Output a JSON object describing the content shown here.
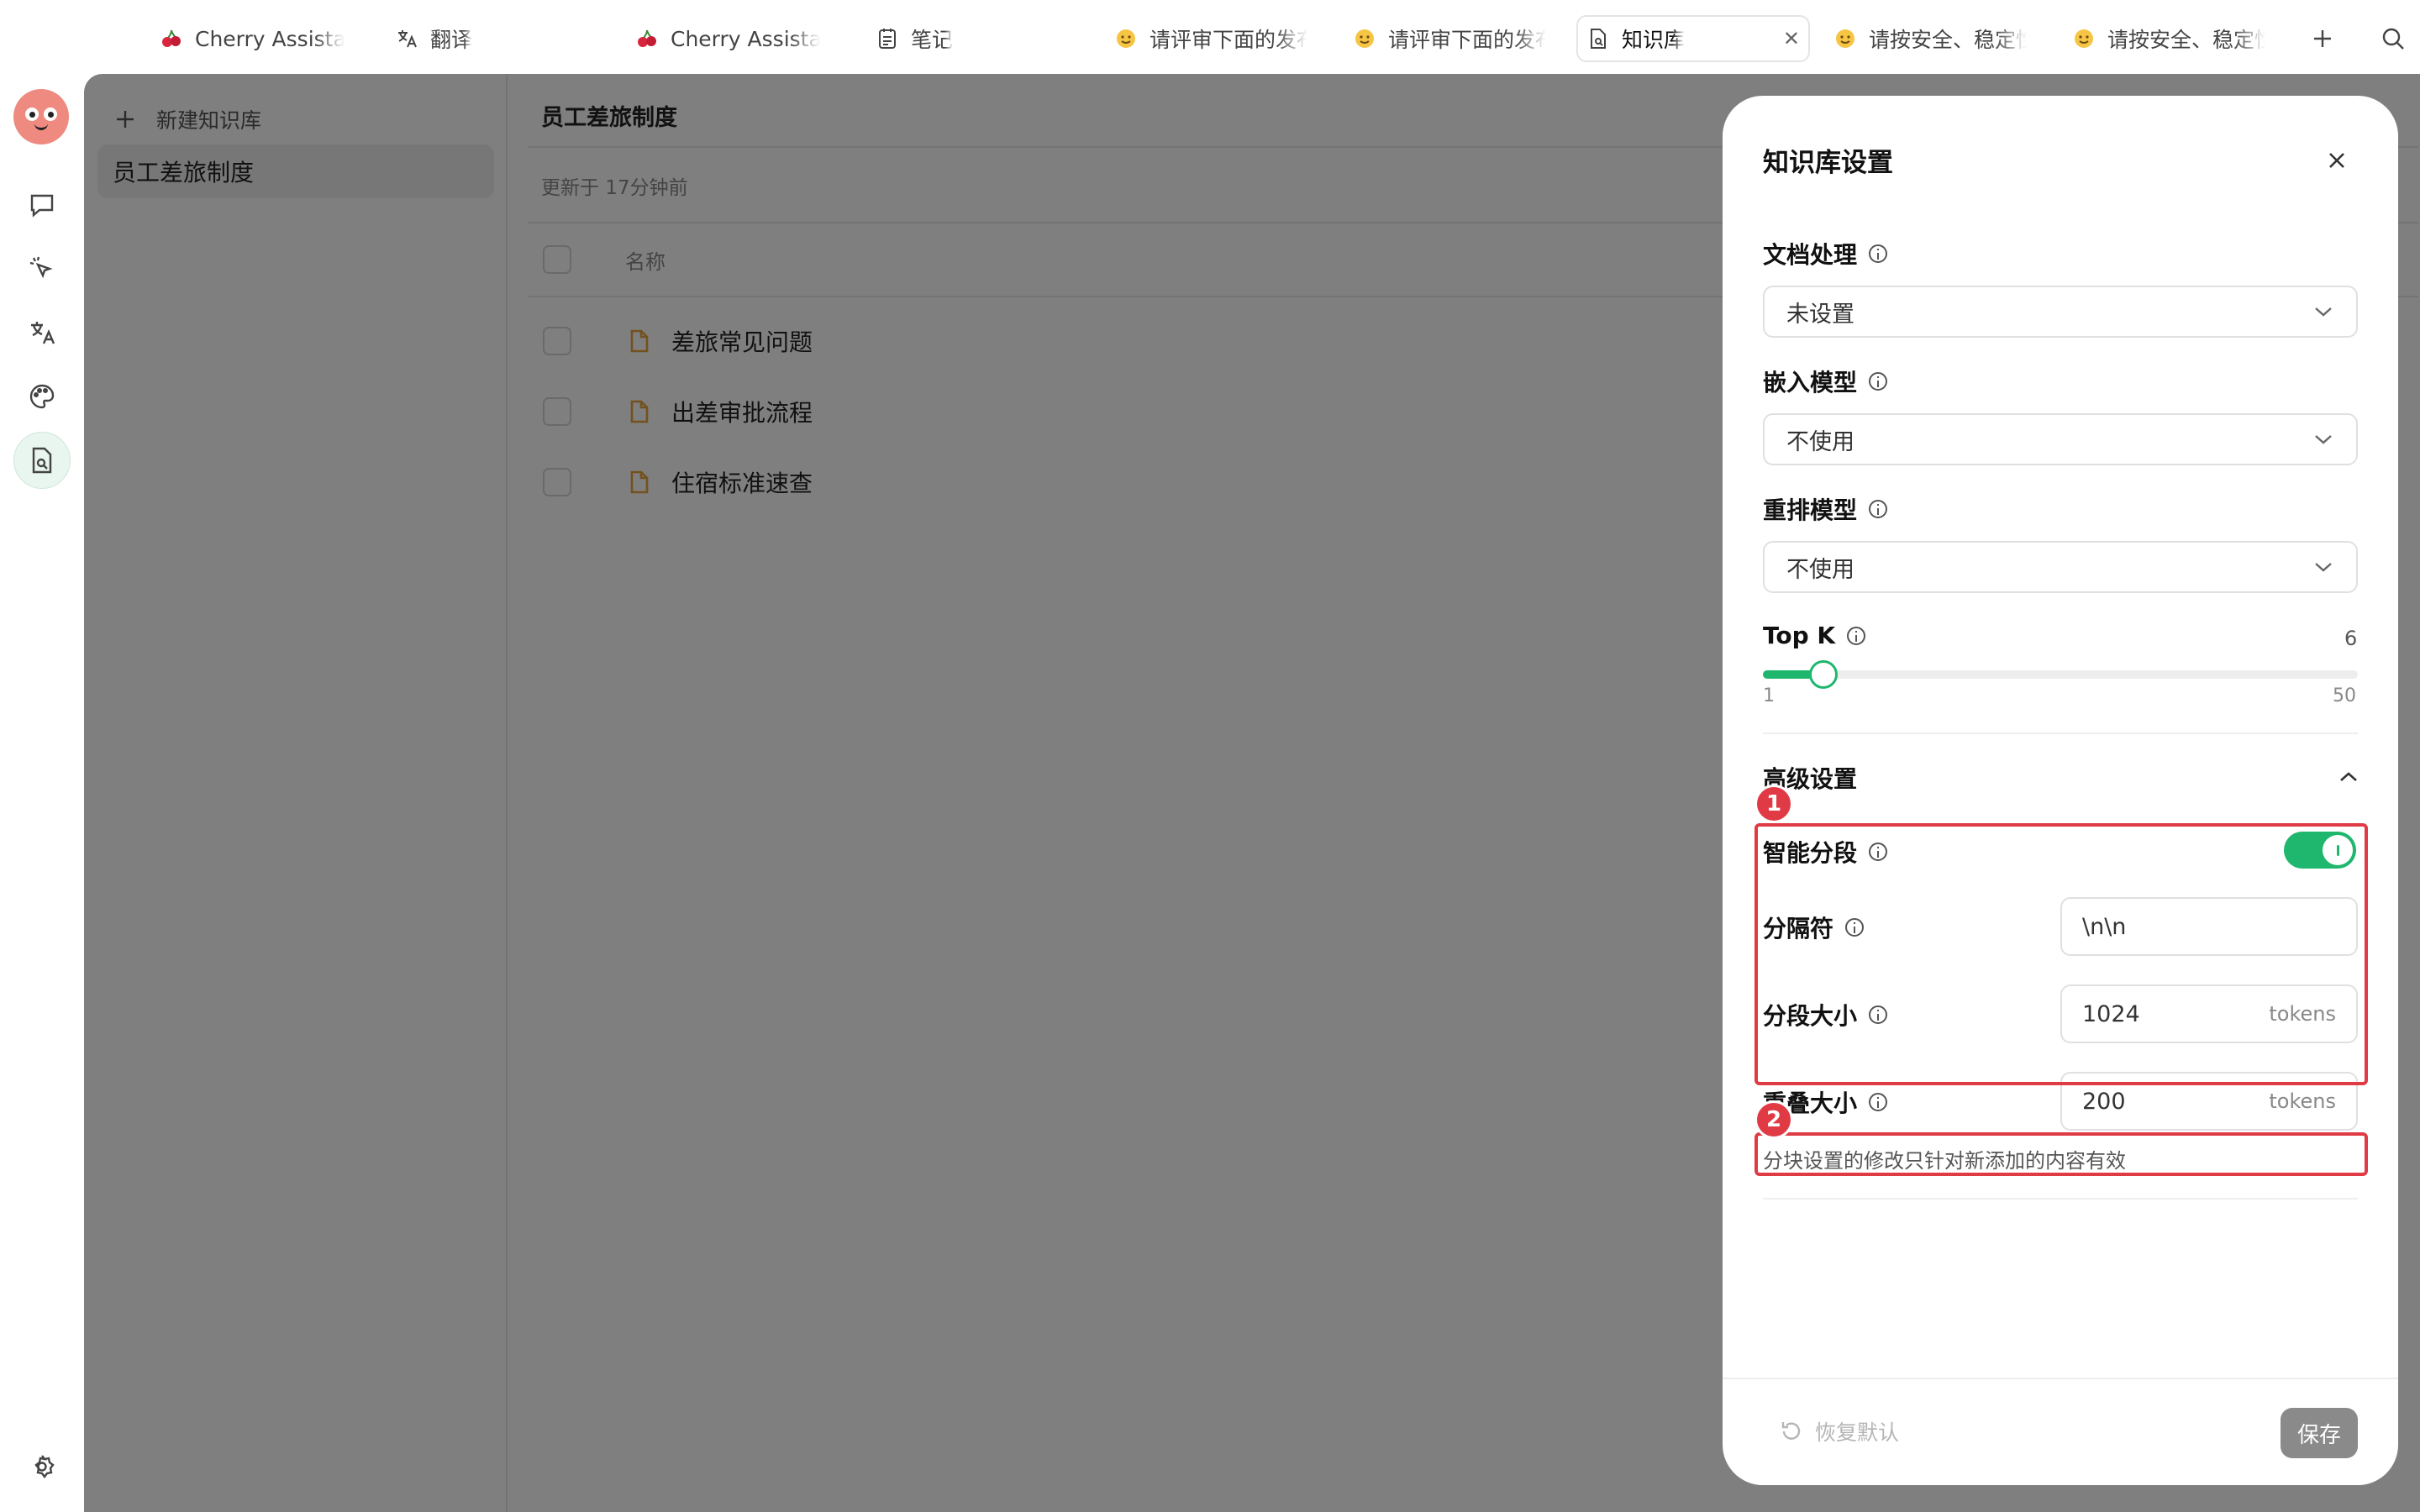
{
  "tabs": [
    {
      "label": "Cherry Assistant",
      "icon": "cherry-icon"
    },
    {
      "label": "翻译",
      "icon": "translate-icon"
    },
    {
      "label": "Cherry Assistant",
      "icon": "cherry-icon"
    },
    {
      "label": "笔记",
      "icon": "notes-icon"
    },
    {
      "label": "请评审下面的发布",
      "icon": "emoji-icon"
    },
    {
      "label": "请评审下面的发布",
      "icon": "emoji-icon"
    },
    {
      "label": "知识库",
      "icon": "knowledge-icon",
      "active": true
    },
    {
      "label": "请按安全、稳定性",
      "icon": "emoji-icon"
    },
    {
      "label": "请按安全、稳定性",
      "icon": "emoji-icon"
    }
  ],
  "sidebar_nav": [
    "chat-icon",
    "agents-icon",
    "translate-icon",
    "paint-icon",
    "knowledge-icon"
  ],
  "kb": {
    "new_label": "新建知识库",
    "items": [
      "员工差旅制度"
    ]
  },
  "content": {
    "title": "员工差旅制度",
    "updated": "更新于 17分钟前",
    "column_name": "名称",
    "files": [
      "差旅常见问题",
      "出差审批流程",
      "住宿标准速查"
    ]
  },
  "settings": {
    "title": "知识库设置",
    "doc_processing": {
      "label": "文档处理",
      "value": "未设置"
    },
    "embedding": {
      "label": "嵌入模型",
      "value": "不使用"
    },
    "rerank": {
      "label": "重排模型",
      "value": "不使用"
    },
    "topk": {
      "label": "Top K",
      "value": 6,
      "min": 1,
      "max": 50
    },
    "advanced": {
      "label": "高级设置"
    },
    "smart_chunk": {
      "label": "智能分段",
      "enabled": true
    },
    "separator": {
      "label": "分隔符",
      "value": "\\n\\n"
    },
    "chunk_size": {
      "label": "分段大小",
      "value": "1024",
      "unit": "tokens"
    },
    "overlap": {
      "label": "重叠大小",
      "value": "200",
      "unit": "tokens"
    },
    "hint": "分块设置的修改只针对新添加的内容有效",
    "reset_label": "恢复默认",
    "save_label": "保存"
  },
  "annotations": [
    "1",
    "2"
  ],
  "colors": {
    "accent": "#1eb76d",
    "annotation": "#e03a45",
    "file_icon": "#e6a23c"
  }
}
